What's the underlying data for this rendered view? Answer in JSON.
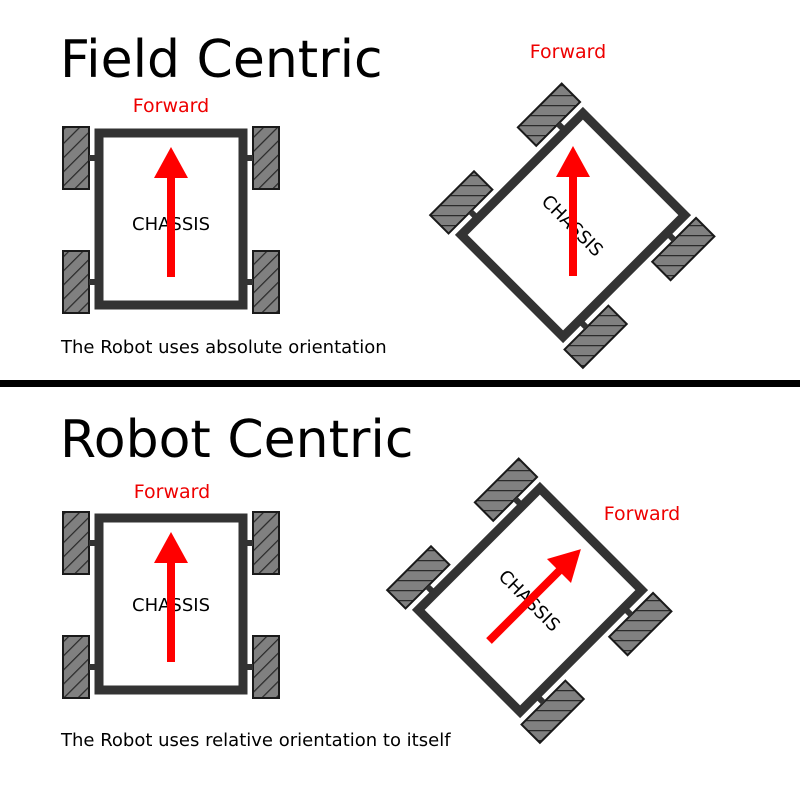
{
  "colors": {
    "arrow": "#ff0000",
    "forward_text": "#ee0000",
    "frame": "#333333",
    "wheel_fill": "#808080",
    "divider": "#000000"
  },
  "field_centric": {
    "title": "Field Centric",
    "caption": "The Robot uses absolute orientation",
    "robot_upright": {
      "forward_label": "Forward",
      "chassis_label": "CHASSIS"
    },
    "robot_rotated": {
      "forward_label": "Forward",
      "chassis_label": "CHASSIS"
    }
  },
  "robot_centric": {
    "title": "Robot Centric",
    "caption": "The Robot uses relative orientation to itself",
    "robot_upright": {
      "forward_label": "Forward",
      "chassis_label": "CHASSIS"
    },
    "robot_rotated": {
      "forward_label": "Forward",
      "chassis_label": "CHASSIS"
    }
  }
}
